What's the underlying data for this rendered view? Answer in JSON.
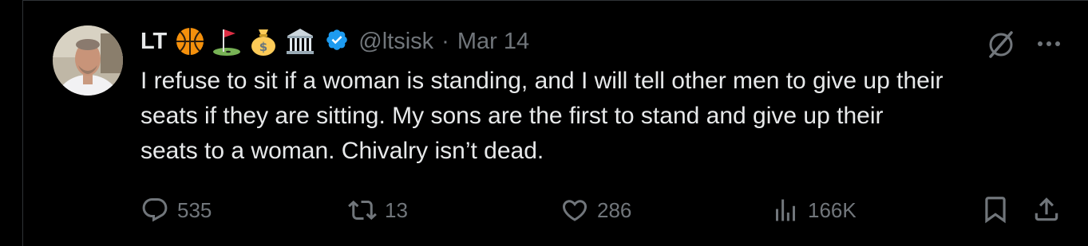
{
  "post": {
    "author_name": "LT",
    "name_emojis": [
      "basketball-emoji",
      "golf-flag-emoji",
      "money-bag-emoji",
      "classical-building-emoji"
    ],
    "handle": "@ltsisk",
    "separator": "·",
    "date": "Mar 14",
    "verified": true,
    "body": "I refuse to sit if a woman is standing, and I will tell other men to give up their\nseats if they are sitting.  My sons are the first to stand and give up their\nseats to a woman.  Chivalry isn’t dead."
  },
  "actions": {
    "replies": "535",
    "reposts": "13",
    "likes": "286",
    "views": "166K"
  },
  "colors": {
    "background": "#000000",
    "text": "#e7e9ea",
    "muted": "#71767b",
    "verified": "#1d9bf0"
  }
}
